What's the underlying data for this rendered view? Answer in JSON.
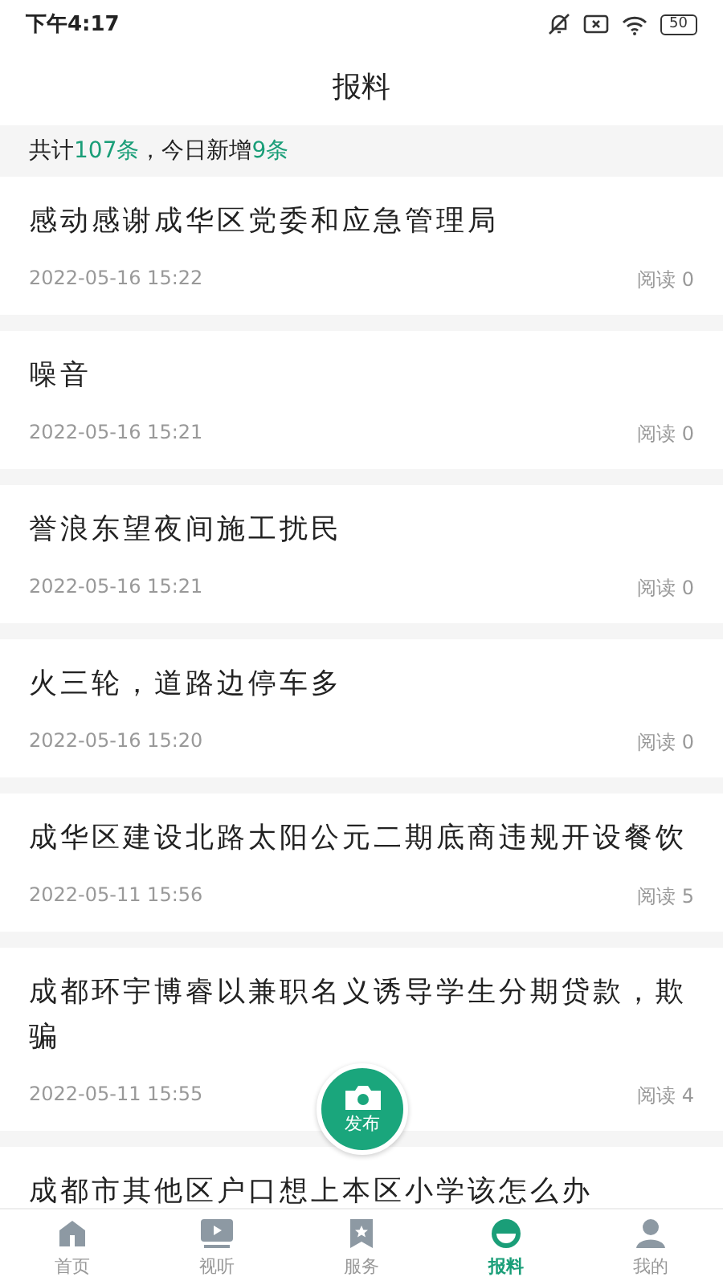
{
  "status_bar": {
    "time": "下午4:17",
    "battery": "50"
  },
  "header": {
    "title": "报料"
  },
  "summary": "共计**107条**，今日新增**9条**",
  "posts": [
    {
      "title": "感动感谢成华区党委和应急管理局",
      "date": "2022-05-16 15:22",
      "reads": "阅读 0"
    },
    {
      "title": "噪音",
      "date": "2022-05-16 15:21",
      "reads": "阅读 0"
    },
    {
      "title": "誉浪东望夜间施工扰民",
      "date": "2022-05-16 15:21",
      "reads": "阅读 0"
    },
    {
      "title": "火三轮，道路边停车多",
      "date": "2022-05-16 15:20",
      "reads": "阅读 0"
    },
    {
      "title": "成华区建设北路太阳公元二期底商违规开设餐饮",
      "date": "2022-05-11 15:56",
      "reads": "阅读 5"
    },
    {
      "title": "成都环宇博睿以兼职名义诱导学生分期贷款，欺骗",
      "date": "2022-05-11 15:55",
      "reads": "阅读 4"
    },
    {
      "title": "成都市其他区户口想上本区小学该怎么办"
    }
  ],
  "publish_button": {
    "label": "发布"
  },
  "tabs": [
    {
      "kind": "home",
      "label": "首页",
      "selected": false
    },
    {
      "kind": "video",
      "label": "视听",
      "selected": false
    },
    {
      "kind": "service",
      "label": "服务",
      "selected": false
    },
    {
      "kind": "report",
      "label": "报料",
      "selected": true
    },
    {
      "kind": "profile",
      "label": "我的",
      "selected": false
    }
  ]
}
